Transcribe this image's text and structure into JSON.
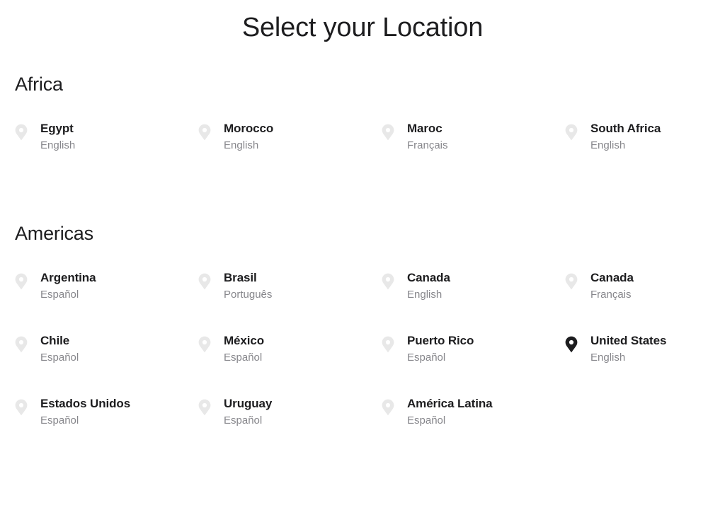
{
  "page": {
    "title": "Select your Location",
    "background_color": "#ffffff",
    "text_color": "#1d1d1f",
    "muted_text_color": "#86868b",
    "pin_unselected_color": "#e8e8e8",
    "pin_selected_color": "#1d1d1f"
  },
  "sections": [
    {
      "id": "africa",
      "title": "Africa",
      "items": [
        {
          "name": "Egypt",
          "language": "English",
          "icon": "map-pin-icon",
          "selected": false
        },
        {
          "name": "Morocco",
          "language": "English",
          "icon": "map-pin-icon",
          "selected": false
        },
        {
          "name": "Maroc",
          "language": "Français",
          "icon": "map-pin-icon",
          "selected": false
        },
        {
          "name": "South Africa",
          "language": "English",
          "icon": "map-pin-icon",
          "selected": false
        }
      ]
    },
    {
      "id": "americas",
      "title": "Americas",
      "items": [
        {
          "name": "Argentina",
          "language": "Español",
          "icon": "map-pin-icon",
          "selected": false
        },
        {
          "name": "Brasil",
          "language": "Português",
          "icon": "map-pin-icon",
          "selected": false
        },
        {
          "name": "Canada",
          "language": "English",
          "icon": "map-pin-icon",
          "selected": false
        },
        {
          "name": "Canada",
          "language": "Français",
          "icon": "map-pin-icon",
          "selected": false
        },
        {
          "name": "Chile",
          "language": "Español",
          "icon": "map-pin-icon",
          "selected": false
        },
        {
          "name": "México",
          "language": "Español",
          "icon": "map-pin-icon",
          "selected": false
        },
        {
          "name": "Puerto Rico",
          "language": "Español",
          "icon": "map-pin-icon",
          "selected": false
        },
        {
          "name": "United States",
          "language": "English",
          "icon": "map-pin-filled-icon",
          "selected": true
        },
        {
          "name": "Estados Unidos",
          "language": "Español",
          "icon": "map-pin-icon",
          "selected": false
        },
        {
          "name": "Uruguay",
          "language": "Español",
          "icon": "map-pin-icon",
          "selected": false
        },
        {
          "name": "América Latina",
          "language": "Español",
          "icon": "map-pin-icon",
          "selected": false
        }
      ]
    }
  ]
}
